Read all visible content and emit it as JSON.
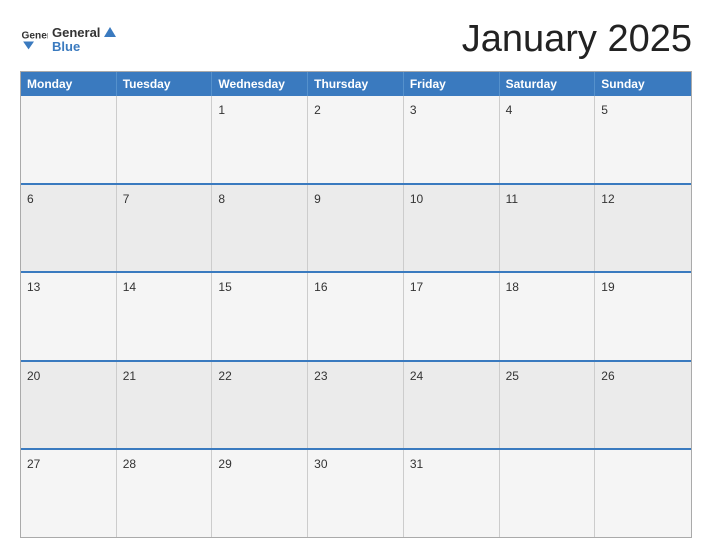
{
  "logo": {
    "line1": "General",
    "line2": "Blue",
    "icon_color": "#3a7abf"
  },
  "title": "January 2025",
  "header": {
    "days": [
      "Monday",
      "Tuesday",
      "Wednesday",
      "Thursday",
      "Friday",
      "Saturday",
      "Sunday"
    ]
  },
  "weeks": [
    [
      null,
      null,
      1,
      2,
      3,
      4,
      5
    ],
    [
      6,
      7,
      8,
      9,
      10,
      11,
      12
    ],
    [
      13,
      14,
      15,
      16,
      17,
      18,
      19
    ],
    [
      20,
      21,
      22,
      23,
      24,
      25,
      26
    ],
    [
      27,
      28,
      29,
      30,
      31,
      null,
      null
    ]
  ]
}
